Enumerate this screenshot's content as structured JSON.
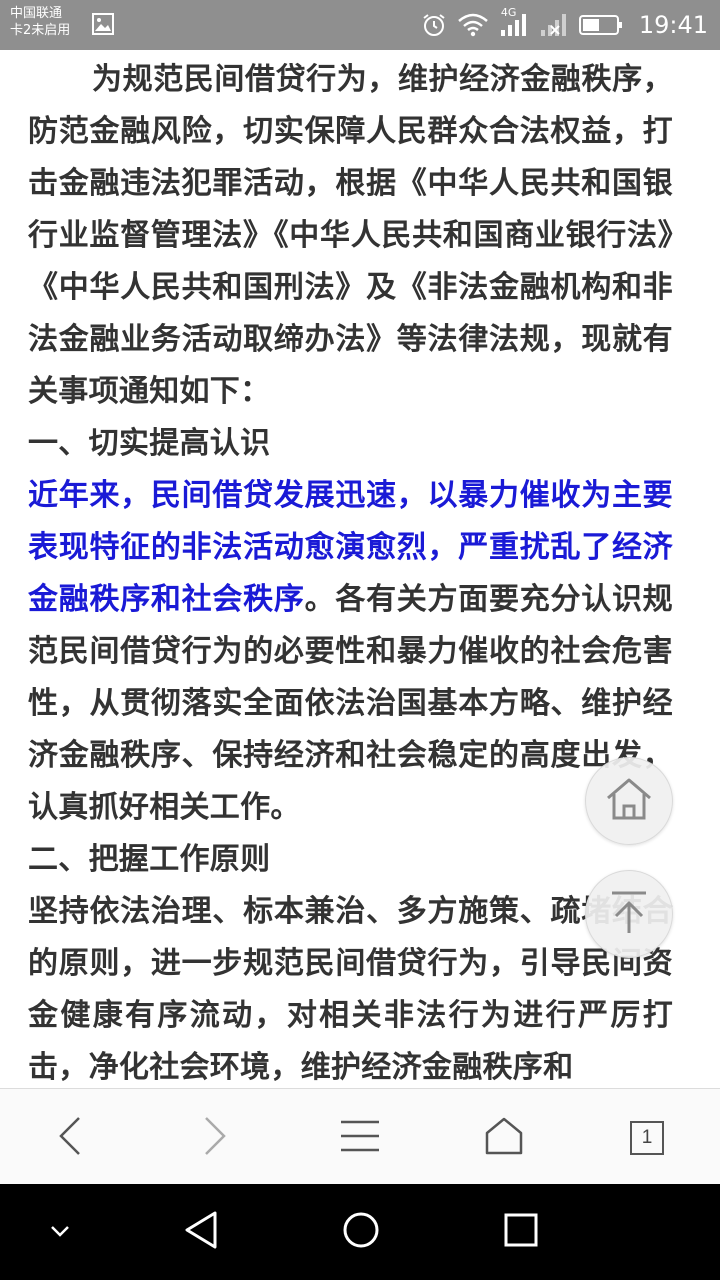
{
  "status_bar": {
    "carrier_line1": "中国联通",
    "carrier_line2": "卡2未启用",
    "network": "4G",
    "time": "19:41"
  },
  "article": {
    "paragraphs": {
      "intro": "为规范民间借贷行为，维护经济金融秩序，防范金融风险，切实保障人民群众合法权益，打击金融违法犯罪活动，根据《中华人民共和国银行业监督管理法》《中华人民共和国商业银行法》《中华人民共和国刑法》及《非法金融机构和非法金融业务活动取缔办法》等法律法规，现就有关事项通知如下：",
      "heading1": "一、切实提高认识",
      "p1_highlight": "近年来，民间借贷发展迅速，以暴力催收为主要表现特征的非法活动愈演愈烈，严重扰乱了经济金融秩序和社会秩序",
      "p1_rest": "。各有关方面要充分认识规范民间借贷行为的必要性和暴力催收的社会危害性，从贯彻落实全面依法治国基本方略、维护经济金融秩序、保持经济和社会稳定的高度出发，认真抓好相关工作。",
      "heading2": "二、把握工作原则",
      "p2": "坚持依法治理、标本兼治、多方施策、疏堵结合的原则，进一步规范民间借贷行为，引导民间资金健康有序流动，对相关非法行为进行严厉打击，净化社会环境，维护经济金融秩序和"
    }
  },
  "colors": {
    "status_bar_bg": "#8f8f8f",
    "text": "#333333",
    "highlight": "#1a1ad6"
  },
  "floating": {
    "home_icon": "home-icon",
    "top_icon": "arrow-up-icon"
  },
  "toolbar": {
    "tab_count": "1"
  }
}
